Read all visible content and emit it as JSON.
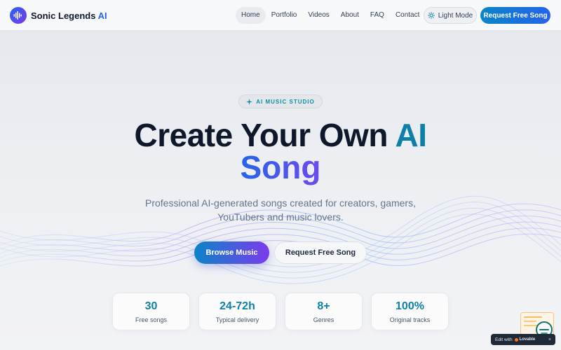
{
  "header": {
    "brand_name": "Sonic Legends ",
    "brand_accent": "AI",
    "nav": [
      "Home",
      "Portfolio",
      "Videos",
      "About",
      "FAQ",
      "Contact"
    ],
    "active_nav": "Home",
    "light_mode_label": "Light Mode",
    "cta_label": "Request Free Song"
  },
  "hero": {
    "badge": "AI MUSIC STUDIO",
    "title_part1": "Create Your Own ",
    "title_accent": "AI",
    "title_line2": "Song",
    "subtitle": "Professional AI-generated songs created for creators, gamers, YouTubers and music lovers.",
    "primary_button": "Browse Music",
    "secondary_button": "Request Free Song"
  },
  "stats": [
    {
      "value": "30",
      "label": "Free songs"
    },
    {
      "value": "24-72h",
      "label": "Typical delivery"
    },
    {
      "value": "8+",
      "label": "Genres"
    },
    {
      "value": "100%",
      "label": "Original tracks"
    }
  ],
  "widgets": {
    "edit_prefix": "Edit with",
    "edit_brand": "Lovable",
    "edit_close": "×"
  },
  "colors": {
    "accent_teal": "#0e7fa8",
    "accent_blue": "#2563eb",
    "accent_purple": "#7c3aed"
  },
  "icons": {
    "brand": "waveform-icon",
    "light_mode": "sun-icon",
    "badge": "sparkle-icon",
    "chat": "chat-icon"
  }
}
